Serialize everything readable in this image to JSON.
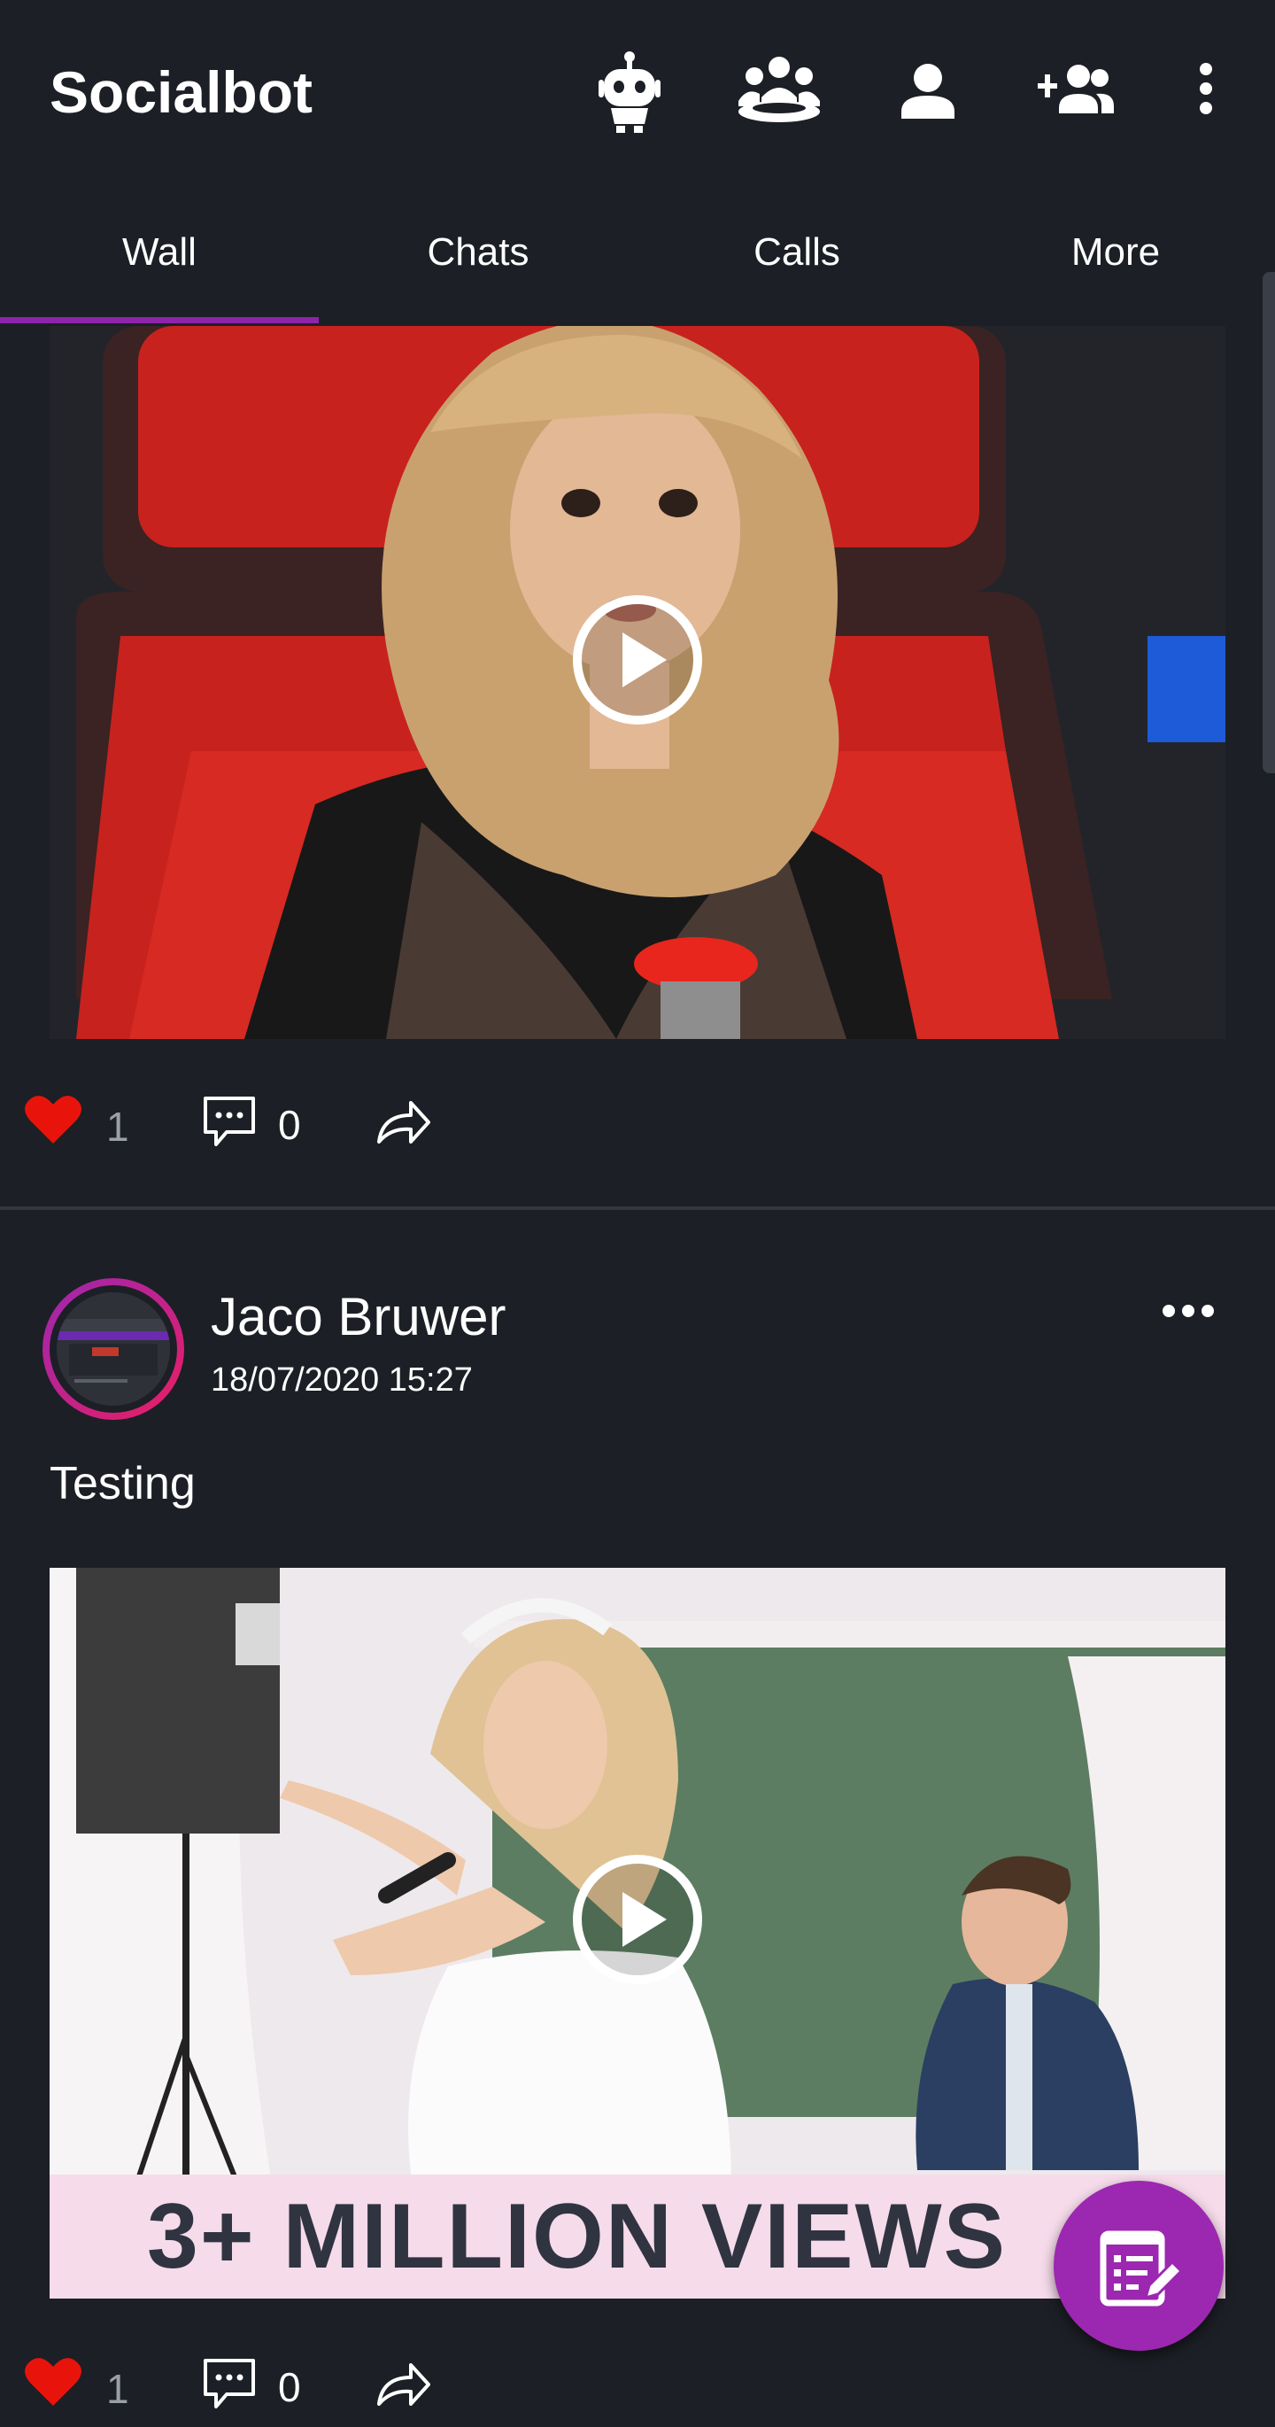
{
  "app": {
    "title": "Socialbot",
    "accent": "#9c27b0",
    "background": "#1c1f25"
  },
  "toolbar_icons": [
    "robot-icon",
    "group-icon",
    "person-icon",
    "person-add-icon",
    "more-vert-icon"
  ],
  "tabs": [
    {
      "label": "Wall",
      "active": true
    },
    {
      "label": "Chats",
      "active": false
    },
    {
      "label": "Calls",
      "active": false
    },
    {
      "label": "More",
      "active": false
    }
  ],
  "posts": [
    {
      "media": "video thumbnail: woman with blonde hair in red chair",
      "likes": "1",
      "comments": "0"
    },
    {
      "author": "Jaco Bruwer",
      "timestamp": "18/07/2020 15:27",
      "text": "Testing",
      "media": "video thumbnail: bride singing at wedding",
      "media_caption": "3+ MILLION VIEWS",
      "likes": "1",
      "comments": "0"
    }
  ],
  "fab": {
    "icon": "compose-icon"
  }
}
